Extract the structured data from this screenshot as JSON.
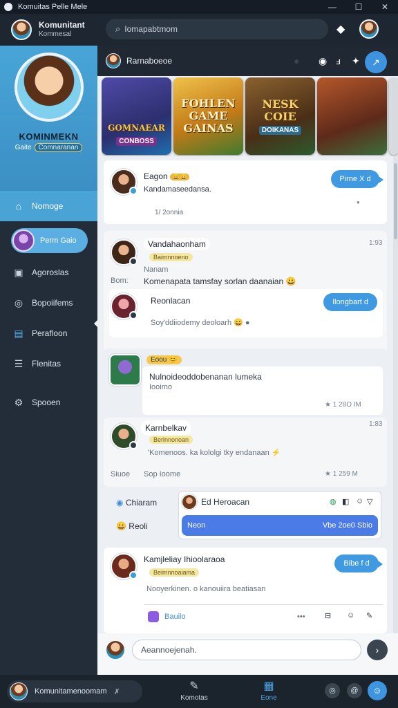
{
  "window": {
    "title": "Komuitas Pelle Mele",
    "controls": [
      "—",
      "☐",
      "✕"
    ]
  },
  "header": {
    "title": "Komunitant",
    "subtitle": "Kommesal",
    "search_placeholder": "Iomapabtmom",
    "icons": [
      "diamond-icon",
      "profile-avatar"
    ]
  },
  "sidebar": {
    "profile_name": "KOMINMEKN",
    "profile_sub_left": "Gaite",
    "profile_sub_badge": "Comnaranan",
    "items": [
      {
        "label": "Nomoge",
        "icon": "home-icon",
        "active": true
      },
      {
        "label": "Perm Gaio",
        "icon": "avatar",
        "pill": true
      },
      {
        "label": "Agoroslas",
        "icon": "image-icon"
      },
      {
        "label": "Bopoiifems",
        "icon": "globe-icon"
      },
      {
        "label": "Perafloon",
        "icon": "chat-icon"
      },
      {
        "label": "Flenitas",
        "icon": "list-icon"
      },
      {
        "label": "Spooen",
        "icon": "gear-icon"
      }
    ]
  },
  "gamebar": {
    "title": "Rarnaboeoe",
    "fab": "↗"
  },
  "games": [
    {
      "big": "GOMNAEAR",
      "sub": "CONBOSS",
      "bg": "#3a3f8e"
    },
    {
      "big": "FOHLEN GAME GAINAS",
      "sub": "",
      "bg": "#c9811d"
    },
    {
      "big": "NESK COIE",
      "sub": "DOIKANAS",
      "bg": "#5b3a1e"
    },
    {
      "big": "",
      "sub": "",
      "bg": "#7a3522"
    }
  ],
  "messages": {
    "m1": {
      "name": "Eagon",
      "badge": "😀😀",
      "line1": "Kandamaseedansa.",
      "line2": "1/ 2onnia",
      "button": "Pirne X d"
    },
    "m2": {
      "name": "Vandahaonham",
      "tag": "Baimnnoeno",
      "line1": "Nanam",
      "label": "Bom:",
      "line2": "Komenapata tamsfay sorlan daanaian 😀",
      "time": "1:93"
    },
    "m3": {
      "name": "Reonlacan",
      "line1": "Soy'ddiiodemy deoloarh 😀 ●",
      "button": "Ilongbart d"
    },
    "m4": {
      "emoji": "Eoou 😊",
      "line1": "Nulnoideoddobenanan lumeka",
      "line2": "Iooimo",
      "time": "★ 1 28O IM"
    },
    "m5": {
      "name": "Karnbelkav",
      "tag": "Berlnnonoan",
      "line1": "'Komenoos. ka kololgi tky endanaan ⚡",
      "time": "1:83",
      "left": "Siuoe",
      "mid": "Sop Ioome",
      "right": "★ 1 259 M"
    },
    "m6": {
      "chip1": "Chiaram",
      "chip2": "Reoli",
      "name": "Ed Heroacan",
      "bar_left": "Neon",
      "bar_right": "Vbe 2oe0 Sbio"
    },
    "m7": {
      "name": "Kamjleliay Ihioolaraoa",
      "tag": "Beimnnoaiama",
      "line1": "Nooyerkinen. o kanouiira beatiasan",
      "reply": "Bauilo",
      "button": "Bibe f d"
    }
  },
  "composer": {
    "placeholder": "Aeannoejenah.",
    "send": "›"
  },
  "bottombar": {
    "status": "Komunitamenoomam",
    "status_icon": "✗",
    "tab1": "Komotas",
    "tab2": "Eone"
  }
}
